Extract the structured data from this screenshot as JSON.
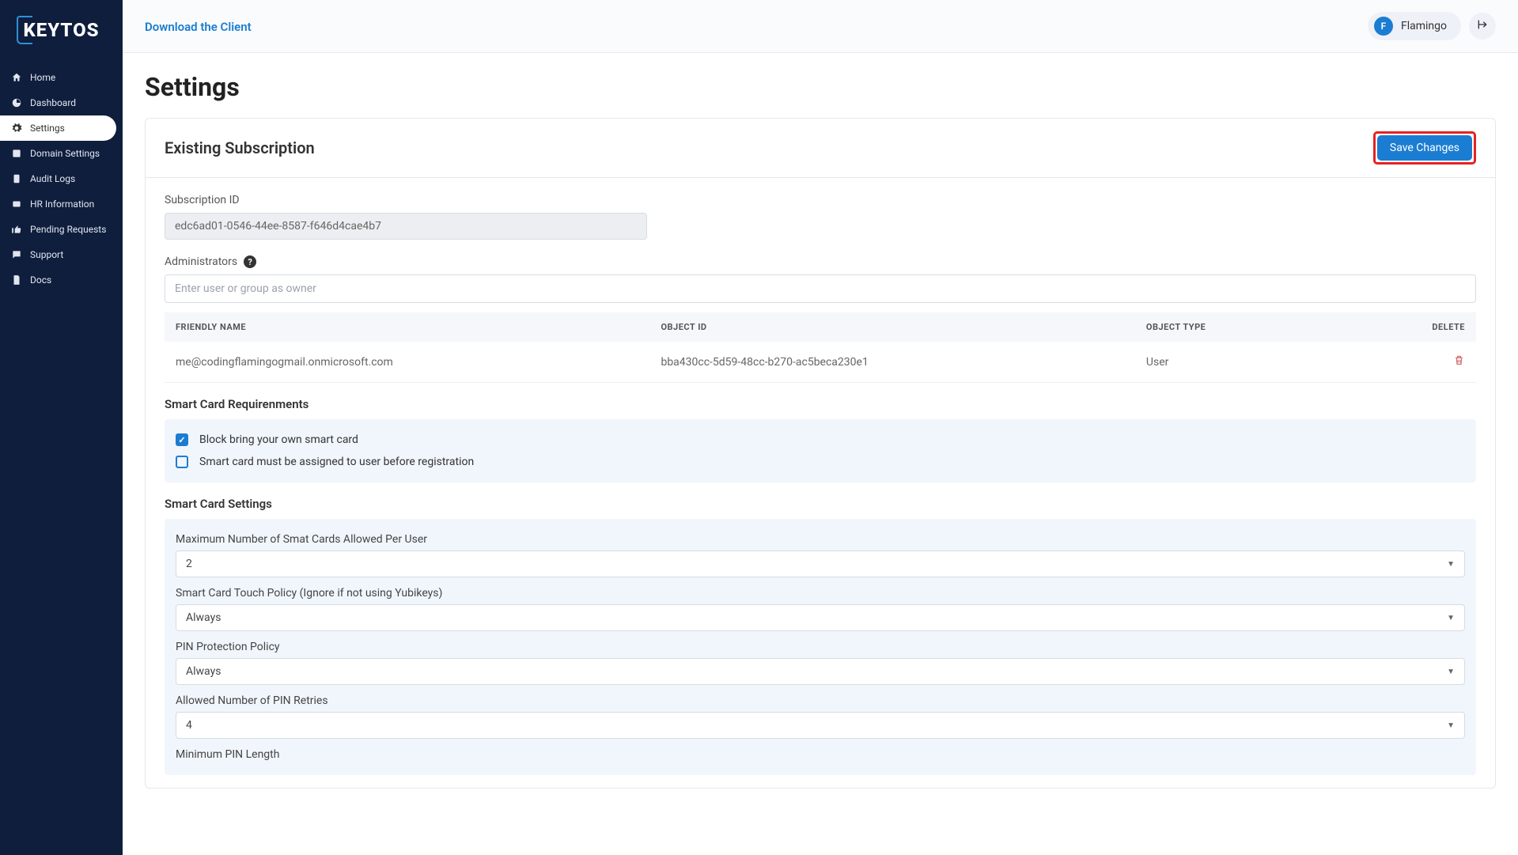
{
  "brand": "KEYTOS",
  "header": {
    "download_link": "Download the Client",
    "user_initial": "F",
    "user_name": "Flamingo"
  },
  "sidebar": {
    "items": [
      {
        "label": "Home",
        "icon": "home"
      },
      {
        "label": "Dashboard",
        "icon": "dashboard"
      },
      {
        "label": "Settings",
        "icon": "gear"
      },
      {
        "label": "Domain Settings",
        "icon": "domain"
      },
      {
        "label": "Audit Logs",
        "icon": "clipboard"
      },
      {
        "label": "HR Information",
        "icon": "id"
      },
      {
        "label": "Pending Requests",
        "icon": "thumb"
      },
      {
        "label": "Support",
        "icon": "chat"
      },
      {
        "label": "Docs",
        "icon": "doc"
      }
    ]
  },
  "page": {
    "title": "Settings",
    "card_title": "Existing Subscription",
    "save_label": "Save Changes",
    "subscription_id_label": "Subscription ID",
    "subscription_id_value": "edc6ad01-0546-44ee-8587-f646d4cae4b7",
    "administrators_label": "Administrators",
    "admin_placeholder": "Enter user or group as owner",
    "admin_table": {
      "headers": [
        "FRIENDLY NAME",
        "OBJECT ID",
        "OBJECT TYPE",
        "DELETE"
      ],
      "rows": [
        {
          "friendly_name": "me@codingflamingogmail.onmicrosoft.com",
          "object_id": "bba430cc-5d59-48cc-b270-ac5beca230e1",
          "object_type": "User"
        }
      ]
    },
    "sc_req_title": "Smart Card Requirenments",
    "sc_req_items": [
      {
        "label": "Block bring your own smart card",
        "checked": true
      },
      {
        "label": "Smart card must be assigned to user before registration",
        "checked": false
      }
    ],
    "sc_settings_title": "Smart Card Settings",
    "sc_settings": [
      {
        "label": "Maximum Number of Smat Cards Allowed Per User",
        "value": "2"
      },
      {
        "label": "Smart Card Touch Policy (Ignore if not using Yubikeys)",
        "value": "Always"
      },
      {
        "label": "PIN Protection Policy",
        "value": "Always"
      },
      {
        "label": "Allowed Number of PIN Retries",
        "value": "4"
      },
      {
        "label": "Minimum PIN Length",
        "value": ""
      }
    ]
  }
}
